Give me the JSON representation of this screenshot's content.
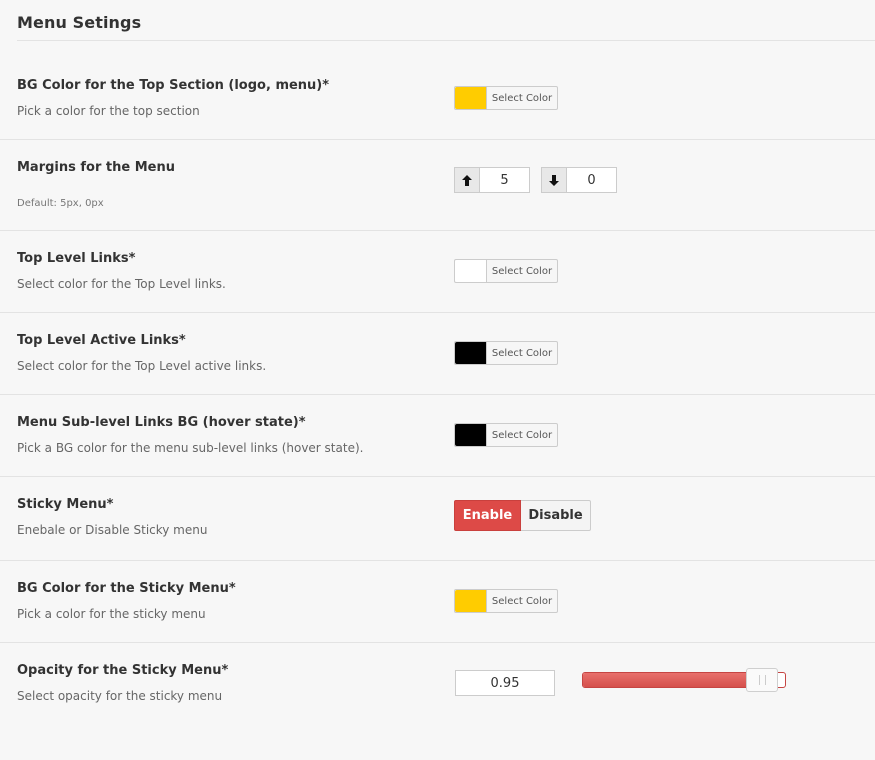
{
  "page": {
    "title": "Menu Setings"
  },
  "top_bg": {
    "label": "BG Color for the Top Section (logo, menu)*",
    "desc": "Pick a color for the top section",
    "color": "#ffcc00",
    "button": "Select Color"
  },
  "margins": {
    "label": "Margins for the Menu",
    "desc": "Default: 5px, 0px",
    "top_icon": "arrow-up-icon",
    "top_value": "5",
    "bottom_icon": "arrow-down-icon",
    "bottom_value": "0"
  },
  "top_links": {
    "label": "Top Level Links*",
    "desc": "Select color for the Top Level links.",
    "color": "#ffffff",
    "button": "Select Color"
  },
  "active_links": {
    "label": "Top Level Active Links*",
    "desc": "Select color for the Top Level active links.",
    "color": "#000000",
    "button": "Select Color"
  },
  "sub_links_bg": {
    "label": "Menu Sub-level Links BG (hover state)*",
    "desc": "Pick a BG color for the menu sub-level links (hover state).",
    "color": "#000000",
    "button": "Select Color"
  },
  "sticky": {
    "label": "Sticky Menu*",
    "desc": "Enebale or Disable Sticky menu",
    "enable": "Enable",
    "disable": "Disable",
    "selected": "Enable",
    "accent": "#dd4a47"
  },
  "sticky_bg": {
    "label": "BG Color for the Sticky Menu*",
    "desc": "Pick a color for the sticky menu",
    "color": "#ffcc00",
    "button": "Select Color"
  },
  "opacity": {
    "label": "Opacity for the Sticky Menu*",
    "desc": "Select opacity for the sticky menu",
    "value": "0.95",
    "slider_fraction": 0.95
  }
}
